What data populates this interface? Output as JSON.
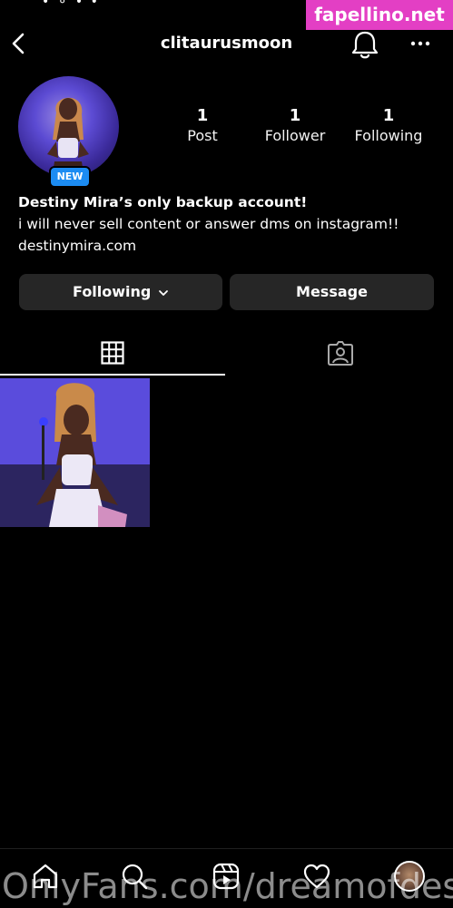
{
  "status": {
    "indicator": "• ⚬ • •"
  },
  "header": {
    "username": "clitaurusmoon"
  },
  "watermark": {
    "top": "fapellino.net",
    "bottom": "OnlyFans.com/dreamofdest"
  },
  "profile": {
    "badge": "NEW",
    "stats": [
      {
        "value": "1",
        "label": "Post"
      },
      {
        "value": "1",
        "label": "Follower"
      },
      {
        "value": "1",
        "label": "Following"
      }
    ],
    "bio": {
      "name": "Destiny Mira’s only backup account!",
      "text": "i will never sell content or answer dms on instagram!!",
      "link": "destinymira.com"
    }
  },
  "actions": {
    "following": "Following",
    "message": "Message"
  },
  "tabs": [
    {
      "name": "posts-grid",
      "icon": "grid-icon"
    },
    {
      "name": "tagged",
      "icon": "tagged-person-icon"
    }
  ],
  "icons": {
    "back": "chevron-left-icon",
    "bell": "bell-icon",
    "more": "more-horizontal-icon",
    "home": "home-icon",
    "search": "search-icon",
    "reels": "reels-icon",
    "activity": "heart-icon"
  },
  "colors": {
    "background": "#000000",
    "button": "#262626",
    "badge": "#1c8cf2",
    "watermark": "#e33fc4"
  }
}
